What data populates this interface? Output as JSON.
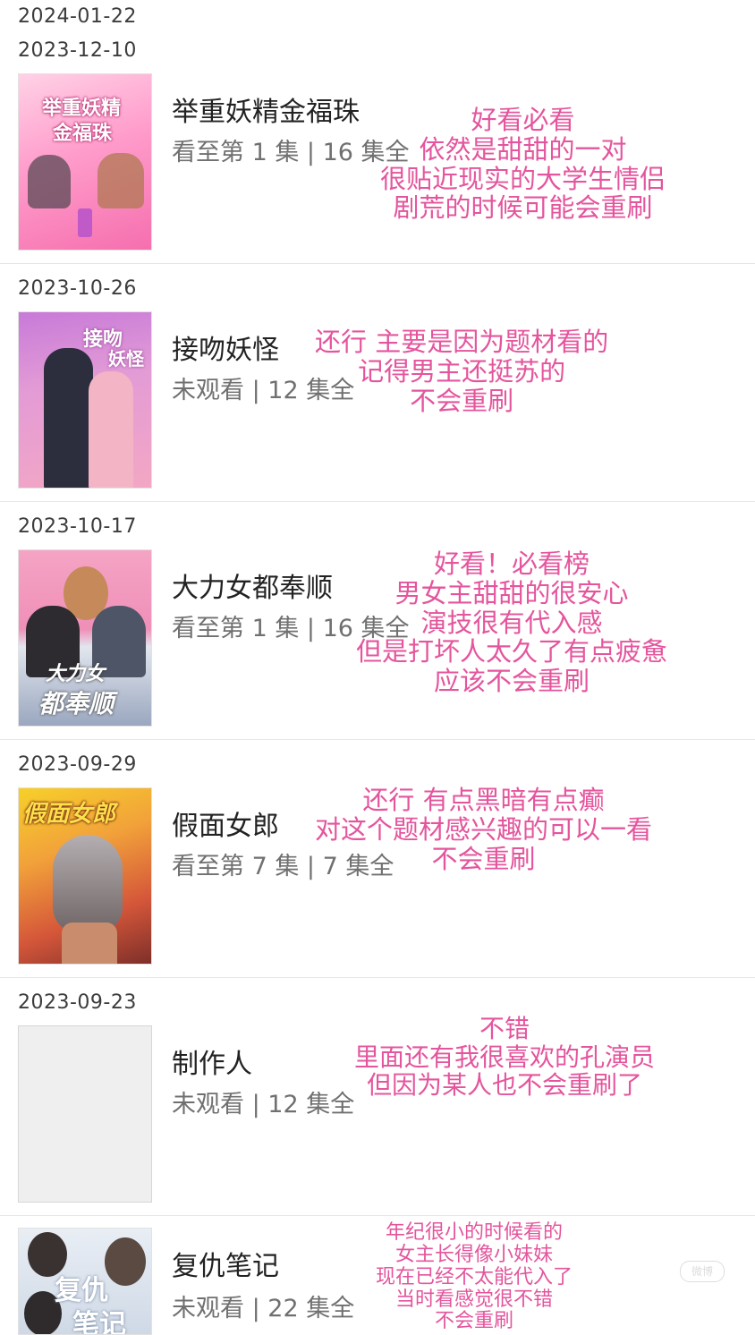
{
  "top_date": "2024-01-22",
  "entries": [
    {
      "date": "2023-12-10",
      "title": "举重妖精金福珠",
      "progress": "看至第 1 集",
      "episodes": "16 集全",
      "poster_text": [
        "举重妖精",
        "金福珠"
      ],
      "note": [
        "好看必看",
        "依然是甜甜的一对",
        "很贴近现实的大学生情侣",
        "剧荒的时候可能会重刷"
      ]
    },
    {
      "date": "2023-10-26",
      "title": "接吻妖怪",
      "progress": "未观看",
      "episodes": "12 集全",
      "poster_text": [
        "接吻",
        "妖怪"
      ],
      "note": [
        "还行 主要是因为题材看的",
        "记得男主还挺苏的",
        "不会重刷"
      ]
    },
    {
      "date": "2023-10-17",
      "title": "大力女都奉顺",
      "progress": "看至第 1 集",
      "episodes": "16 集全",
      "poster_text": [
        "大力女",
        "都奉顺"
      ],
      "note": [
        "好看！必看榜",
        "男女主甜甜的很安心",
        "演技很有代入感",
        "但是打坏人太久了有点疲惫",
        "应该不会重刷"
      ]
    },
    {
      "date": "2023-09-29",
      "title": "假面女郎",
      "progress": "看至第 7 集",
      "episodes": "7 集全",
      "poster_text": [
        "假面女郎"
      ],
      "note": [
        "还行 有点黑暗有点癫",
        "对这个题材感兴趣的可以一看",
        "不会重刷"
      ]
    },
    {
      "date": "2023-09-23",
      "title": "制作人",
      "progress": "未观看",
      "episodes": "12 集全",
      "poster_text": [],
      "note": [
        "不错",
        "里面还有我很喜欢的孔演员",
        "但因为某人也不会重刷了"
      ]
    },
    {
      "date": "",
      "title": "复仇笔记",
      "progress": "未观看",
      "episodes": "22 集全",
      "poster_text": [
        "复仇",
        "笔记"
      ],
      "note": [
        "年纪很小的时候看的",
        "女主长得像小妹妹",
        "现在已经不太能代入了",
        "当时看感觉很不错",
        "不会重刷"
      ]
    }
  ],
  "watermark": "微博",
  "colors": {
    "note": "#e4559d",
    "title": "#222222",
    "status": "#707070",
    "date": "#3c3c3c"
  }
}
